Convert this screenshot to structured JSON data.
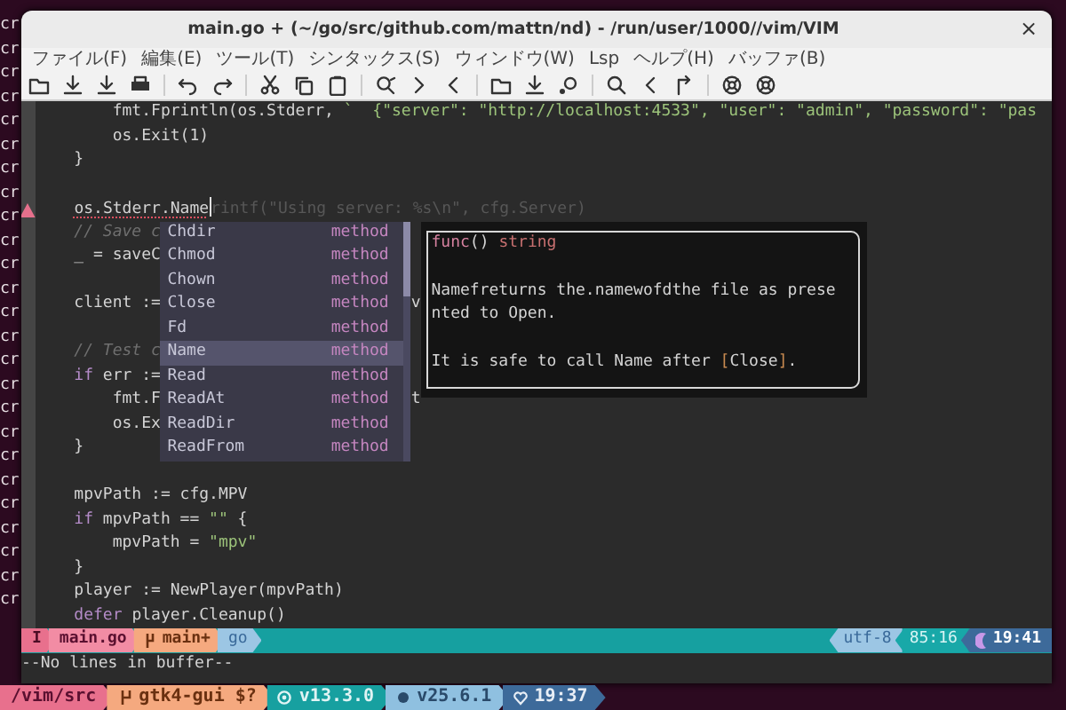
{
  "background_terminal": {
    "lines": [
      "cr",
      "cr",
      "cr",
      "cr",
      "cr",
      "cr",
      "cr",
      "cr",
      "cr",
      "cr",
      "cr",
      "cr",
      "cr",
      "cr",
      "cr",
      "cr",
      "cr",
      "cr",
      "cr",
      "cr",
      "cr",
      "cr",
      "cr",
      "cr",
      "cr"
    ],
    "status": [
      {
        "kind": "path",
        "text": "/vim/src"
      },
      {
        "kind": "branch",
        "text": "gtk4-gui $?"
      },
      {
        "kind": "node",
        "text": "v13.3.0"
      },
      {
        "kind": "runtime",
        "text": "v25.6.1"
      },
      {
        "kind": "time",
        "text": "19:37"
      }
    ]
  },
  "window": {
    "title": "main.go + (~/go/src/github.com/mattn/nd) - /run/user/1000//vim/VIM",
    "close": "×"
  },
  "menu": [
    "ファイル(F)",
    "編集(E)",
    "ツール(T)",
    "シンタックス(S)",
    "ウィンドウ(W)",
    "Lsp",
    "ヘルプ(H)",
    "バッファ(B)"
  ],
  "editor": {
    "lines": [
      {
        "kind": "code",
        "segments": [
          {
            "kind": "text",
            "text": "        fmt.Fprintln(os.Stderr, "
          },
          {
            "kind": "string",
            "text": "`  {\"server\": \"http://localhost:4533\", \"user\": \"admin\", \"password\": \"pas"
          }
        ]
      },
      {
        "kind": "code",
        "segments": [
          {
            "kind": "text",
            "text": "        os.Exit(1)"
          }
        ]
      },
      {
        "kind": "code",
        "segments": [
          {
            "kind": "text",
            "text": "    }"
          }
        ]
      },
      {
        "kind": "blank"
      },
      {
        "kind": "code",
        "warning_sign": true,
        "cursor": true,
        "segments": [
          {
            "kind": "error",
            "text": "    os.Stderr.Name"
          },
          {
            "kind": "ghost",
            "text": "rintf(\"Using server: %s\\n\", cfg.Server)"
          }
        ]
      },
      {
        "kind": "code",
        "segments": [
          {
            "kind": "comment",
            "text": "    // Save c"
          }
        ]
      },
      {
        "kind": "code",
        "segments": [
          {
            "kind": "text",
            "text": "    _ = saveC"
          }
        ]
      },
      {
        "kind": "blank"
      },
      {
        "kind": "code",
        "segments": [
          {
            "kind": "text",
            "text": "    client :="
          },
          {
            "kind": "peek",
            "text": "v"
          }
        ]
      },
      {
        "kind": "blank"
      },
      {
        "kind": "code",
        "segments": [
          {
            "kind": "comment",
            "text": "    // Test c"
          }
        ]
      },
      {
        "kind": "code",
        "segments": [
          {
            "kind": "keyword",
            "text": "    if"
          },
          {
            "kind": "text",
            "text": " err :="
          }
        ]
      },
      {
        "kind": "code",
        "segments": [
          {
            "kind": "text",
            "text": "        fmt.F"
          },
          {
            "kind": "peek",
            "text": "t"
          }
        ]
      },
      {
        "kind": "code",
        "segments": [
          {
            "kind": "text",
            "text": "        os.Ex"
          }
        ]
      },
      {
        "kind": "code",
        "segments": [
          {
            "kind": "text",
            "text": "    }"
          }
        ]
      },
      {
        "kind": "blank"
      },
      {
        "kind": "code",
        "segments": [
          {
            "kind": "text",
            "text": "    mpvPath := cfg.MPV"
          }
        ]
      },
      {
        "kind": "code",
        "segments": [
          {
            "kind": "keyword",
            "text": "    if"
          },
          {
            "kind": "text",
            "text": " mpvPath == "
          },
          {
            "kind": "string",
            "text": "\"\""
          },
          {
            "kind": "text",
            "text": " {"
          }
        ]
      },
      {
        "kind": "code",
        "segments": [
          {
            "kind": "text",
            "text": "        mpvPath = "
          },
          {
            "kind": "string",
            "text": "\"mpv\""
          }
        ]
      },
      {
        "kind": "code",
        "segments": [
          {
            "kind": "text",
            "text": "    }"
          }
        ]
      },
      {
        "kind": "code",
        "segments": [
          {
            "kind": "text",
            "text": "    player := NewPlayer(mpvPath)"
          }
        ]
      },
      {
        "kind": "code",
        "segments": [
          {
            "kind": "keyword",
            "text": "    defer"
          },
          {
            "kind": "text",
            "text": " player.Cleanup()"
          }
        ]
      }
    ],
    "completion": {
      "items": [
        {
          "label": "Chdir",
          "type": "method",
          "selected": false
        },
        {
          "label": "Chmod",
          "type": "method",
          "selected": false
        },
        {
          "label": "Chown",
          "type": "method",
          "selected": false
        },
        {
          "label": "Close",
          "type": "method",
          "selected": false
        },
        {
          "label": "Fd",
          "type": "method",
          "selected": false
        },
        {
          "label": "Name",
          "type": "method",
          "selected": true
        },
        {
          "label": "Read",
          "type": "method",
          "selected": false
        },
        {
          "label": "ReadAt",
          "type": "method",
          "selected": false
        },
        {
          "label": "ReadDir",
          "type": "method",
          "selected": false
        },
        {
          "label": "ReadFrom",
          "type": "method",
          "selected": false
        }
      ]
    },
    "doc": {
      "lines": [
        {
          "kind": "code",
          "segments": [
            {
              "kind": "keyword",
              "text": "func"
            },
            {
              "kind": "text",
              "text": "() "
            },
            {
              "kind": "type",
              "text": "string"
            }
          ]
        },
        {
          "kind": "blank"
        },
        {
          "kind": "code",
          "segments": [
            {
              "kind": "text",
              "text": "Namefreturns the.namewofdthe file as prese"
            }
          ]
        },
        {
          "kind": "code",
          "segments": [
            {
              "kind": "text",
              "text": "nted to Open."
            }
          ]
        },
        {
          "kind": "blank"
        },
        {
          "kind": "code",
          "segments": [
            {
              "kind": "text",
              "text": "It is safe to call Name after "
            },
            {
              "kind": "bracket",
              "text": "["
            },
            {
              "kind": "text",
              "text": "Close"
            },
            {
              "kind": "bracket",
              "text": "]"
            },
            {
              "kind": "text",
              "text": "."
            }
          ]
        }
      ]
    }
  },
  "statusline": {
    "mode": "I",
    "file": "main.go",
    "branch": "main+",
    "filetype": "go",
    "encoding": "utf-8",
    "position": "85:16",
    "time": "19:41"
  },
  "cmdline": "--No lines in buffer--"
}
